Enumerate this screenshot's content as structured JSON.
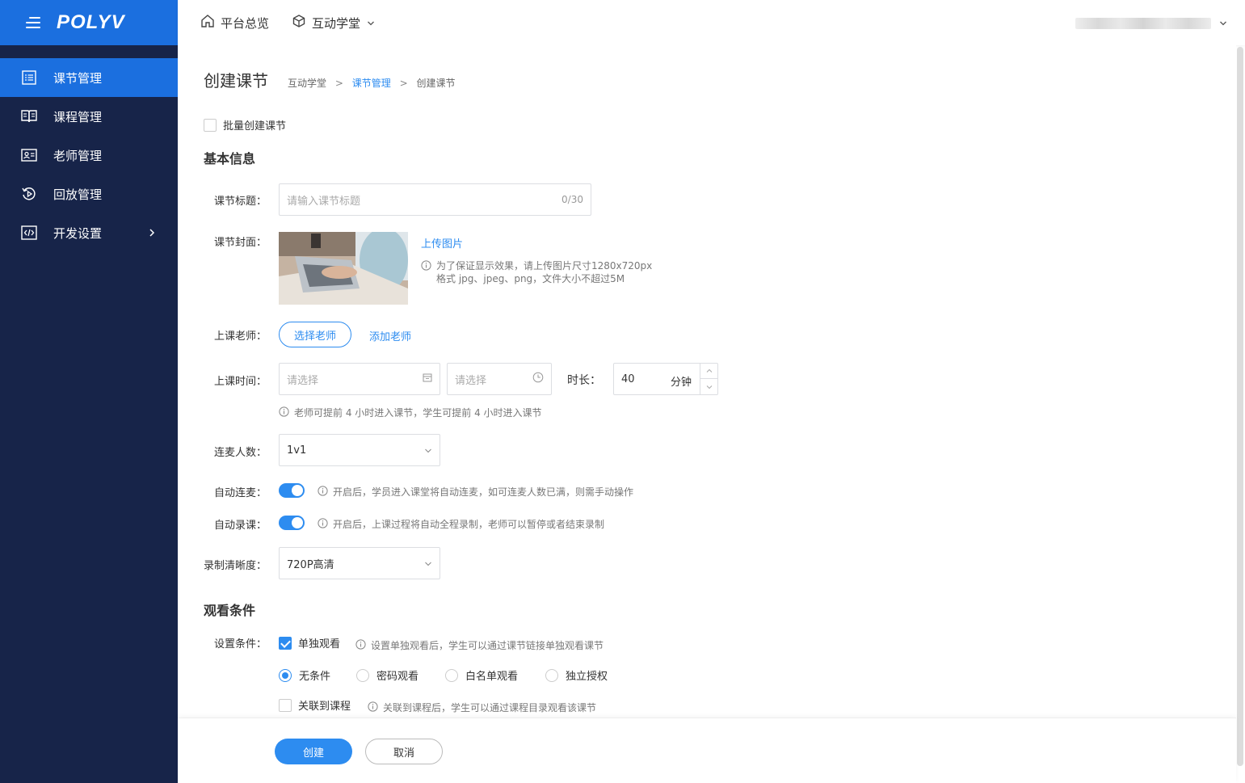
{
  "brand": {
    "logo": "POLYV"
  },
  "sidebar": {
    "items": [
      {
        "label": "课节管理",
        "icon": "list-icon",
        "active": true
      },
      {
        "label": "课程管理",
        "icon": "book-icon",
        "active": false
      },
      {
        "label": "老师管理",
        "icon": "id-card-icon",
        "active": false
      },
      {
        "label": "回放管理",
        "icon": "replay-icon",
        "active": false
      },
      {
        "label": "开发设置",
        "icon": "code-icon",
        "active": false
      }
    ]
  },
  "header": {
    "overview": "平台总览",
    "classroom": "互动学堂"
  },
  "page": {
    "title": "创建课节",
    "breadcrumb": [
      "互动学堂",
      "课节管理",
      "创建课节"
    ]
  },
  "form": {
    "batch_create": "批量创建课节",
    "basic_section": "基本信息",
    "title_label": "课节标题：",
    "title_placeholder": "请输入课节标题",
    "title_counter": "0/30",
    "cover_label": "课节封面：",
    "upload_link": "上传图片",
    "upload_hint_line1": "为了保证显示效果，请上传图片尺寸1280x720px",
    "upload_hint_line2": "格式 jpg、jpeg、png，文件大小不超过5M",
    "teacher_label": "上课老师：",
    "select_teacher": "选择老师",
    "add_teacher": "添加老师",
    "time_label": "上课时间：",
    "date_placeholder": "请选择",
    "time_placeholder": "请选择",
    "duration_label": "时长：",
    "duration_value": "40",
    "duration_unit": "分钟",
    "time_hint": "老师可提前 4 小时进入课节，学生可提前 4 小时进入课节",
    "mic_label": "连麦人数：",
    "mic_value": "1v1",
    "auto_mic_label": "自动连麦：",
    "auto_mic_hint": "开启后，学员进入课堂将自动连麦，如可连麦人数已满，则需手动操作",
    "auto_record_label": "自动录课：",
    "auto_record_hint": "开启后，上课过程将自动全程录制，老师可以暂停或者结束录制",
    "quality_label": "录制清晰度：",
    "quality_value": "720P高清",
    "watch_section": "观看条件",
    "condition_label": "设置条件：",
    "single_watch": "单独观看",
    "single_watch_hint": "设置单独观看后，学生可以通过课节链接单独观看课节",
    "radios": [
      "无条件",
      "密码观看",
      "白名单观看",
      "独立授权"
    ],
    "link_course": "关联到课程",
    "link_course_hint": "关联到课程后，学生可以通过课程目录观看该课节"
  },
  "footer": {
    "create": "创建",
    "cancel": "取消"
  },
  "colors": {
    "sidebar_bg": "#172449",
    "accent": "#1b6fdf",
    "link": "#2d8cf0"
  }
}
